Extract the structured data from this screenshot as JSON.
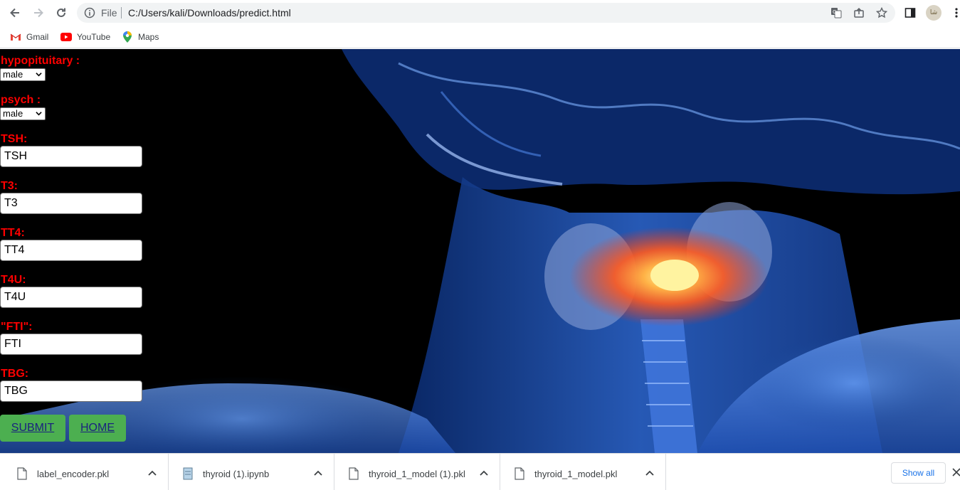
{
  "browser": {
    "omnibox": {
      "scheme_label": "File",
      "url": "C:/Users/kali/Downloads/predict.html"
    },
    "profile_initials": "ﺷﺎ",
    "bookmarks": [
      {
        "label": "Gmail",
        "icon": "gmail-icon"
      },
      {
        "label": "YouTube",
        "icon": "youtube-icon"
      },
      {
        "label": "Maps",
        "icon": "maps-icon"
      }
    ]
  },
  "form": {
    "hypopituitary": {
      "label": "hypopituitary :",
      "selected": "male"
    },
    "psych": {
      "label": "psych :",
      "selected": "male"
    },
    "tsh": {
      "label": "TSH:",
      "placeholder": "TSH"
    },
    "t3": {
      "label": "T3:",
      "placeholder": "T3"
    },
    "tt4": {
      "label": "TT4:",
      "placeholder": "TT4"
    },
    "t4u": {
      "label": "T4U:",
      "placeholder": "T4U"
    },
    "fti": {
      "label": "\"FTI\":",
      "placeholder": "FTI"
    },
    "tbg": {
      "label": "TBG:",
      "placeholder": "TBG"
    },
    "submit_label": "SUBMIT",
    "home_label": "HOME"
  },
  "downloads": {
    "items": [
      {
        "name": "label_encoder.pkl",
        "icon": "file-icon"
      },
      {
        "name": "thyroid (1).ipynb",
        "icon": "notebook-file-icon"
      },
      {
        "name": "thyroid_1_model (1).pkl",
        "icon": "file-icon"
      },
      {
        "name": "thyroid_1_model.pkl",
        "icon": "file-icon"
      }
    ],
    "show_all_label": "Show all"
  },
  "colors": {
    "label_red": "#ff0000",
    "button_green": "#4caf50",
    "button_text": "#1a237e",
    "background": "#000000"
  }
}
